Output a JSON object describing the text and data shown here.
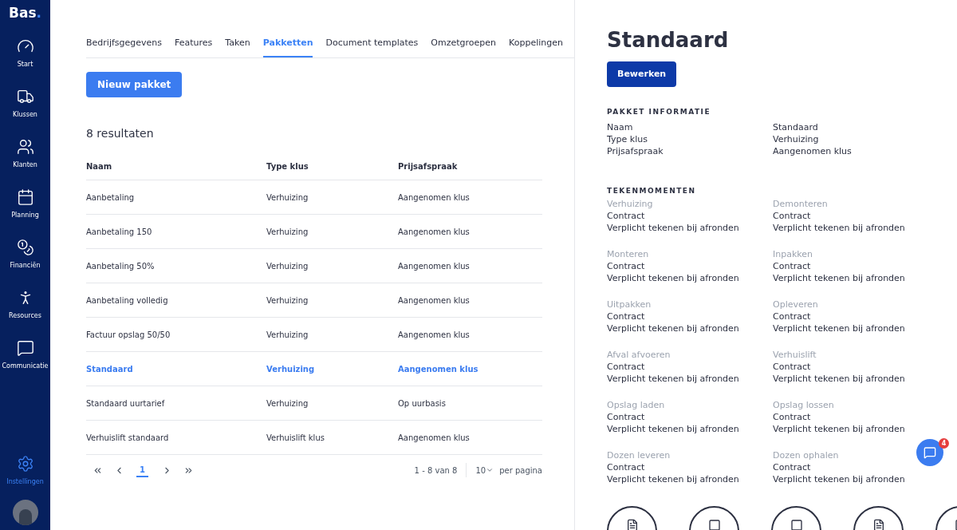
{
  "sidebar": {
    "logo": "Bas",
    "logo_dot": ".",
    "items": [
      {
        "label": "Start",
        "selected": false
      },
      {
        "label": "Klussen",
        "selected": false
      },
      {
        "label": "Klanten",
        "selected": false
      },
      {
        "label": "Planning",
        "selected": false
      },
      {
        "label": "Financiën",
        "selected": false
      },
      {
        "label": "Resources",
        "selected": false
      },
      {
        "label": "Communicatie",
        "selected": false
      }
    ],
    "bottom_item": {
      "label": "Instellingen",
      "selected": true
    }
  },
  "tabs": [
    {
      "label": "Bedrijfsgegevens",
      "selected": false
    },
    {
      "label": "Features",
      "selected": false
    },
    {
      "label": "Taken",
      "selected": false
    },
    {
      "label": "Pakketten",
      "selected": true
    },
    {
      "label": "Document templates",
      "selected": false
    },
    {
      "label": "Omzetgroepen",
      "selected": false
    },
    {
      "label": "Koppelingen",
      "selected": false
    }
  ],
  "new_button": "Nieuw pakket",
  "result_count": "8 resultaten",
  "table": {
    "columns": [
      "Naam",
      "Type klus",
      "Prijsafspraak"
    ],
    "rows": [
      {
        "cells": [
          "Aanbetaling",
          "Verhuizing",
          "Aangenomen klus"
        ],
        "selected": false
      },
      {
        "cells": [
          "Aanbetaling 150",
          "Verhuizing",
          "Aangenomen klus"
        ],
        "selected": false
      },
      {
        "cells": [
          "Aanbetaling 50%",
          "Verhuizing",
          "Aangenomen klus"
        ],
        "selected": false
      },
      {
        "cells": [
          "Aanbetaling volledig",
          "Verhuizing",
          "Aangenomen klus"
        ],
        "selected": false
      },
      {
        "cells": [
          "Factuur opslag 50/50",
          "Verhuizing",
          "Aangenomen klus"
        ],
        "selected": false
      },
      {
        "cells": [
          "Standaard",
          "Verhuizing",
          "Aangenomen klus"
        ],
        "selected": true
      },
      {
        "cells": [
          "Standaard uurtarief",
          "Verhuizing",
          "Op uurbasis"
        ],
        "selected": false
      },
      {
        "cells": [
          "Verhuislift standaard",
          "Verhuislift klus",
          "Aangenomen klus"
        ],
        "selected": false
      }
    ]
  },
  "pagination": {
    "current_page": "1",
    "range": "1 - 8 van 8",
    "page_size": "10",
    "per_page": "per pagina"
  },
  "detail": {
    "title": "Standaard",
    "edit_button": "Bewerken",
    "info_heading": "PAKKET INFORMATIE",
    "info": [
      {
        "label": "Naam",
        "value": "Standaard"
      },
      {
        "label": "Type klus",
        "value": "Verhuizing"
      },
      {
        "label": "Prijsafspraak",
        "value": "Aangenomen klus"
      }
    ],
    "moments_heading": "TEKENMOMENTEN",
    "moments": [
      {
        "name": "Verhuizing",
        "document": "Contract",
        "rule": "Verplicht tekenen bij afronden"
      },
      {
        "name": "Demonteren",
        "document": "Contract",
        "rule": "Verplicht tekenen bij afronden"
      },
      {
        "name": "Monteren",
        "document": "Contract",
        "rule": "Verplicht tekenen bij afronden"
      },
      {
        "name": "Inpakken",
        "document": "Contract",
        "rule": "Verplicht tekenen bij afronden"
      },
      {
        "name": "Uitpakken",
        "document": "Contract",
        "rule": "Verplicht tekenen bij afronden"
      },
      {
        "name": "Opleveren",
        "document": "Contract",
        "rule": "Verplicht tekenen bij afronden"
      },
      {
        "name": "Afval afvoeren",
        "document": "Contract",
        "rule": "Verplicht tekenen bij afronden"
      },
      {
        "name": "Verhuislift",
        "document": "Contract",
        "rule": "Verplicht tekenen bij afronden"
      },
      {
        "name": "Opslag laden",
        "document": "Contract",
        "rule": "Verplicht tekenen bij afronden"
      },
      {
        "name": "Opslag lossen",
        "document": "Contract",
        "rule": "Verplicht tekenen bij afronden"
      },
      {
        "name": "Dozen leveren",
        "document": "Contract",
        "rule": "Verplicht tekenen bij afronden"
      },
      {
        "name": "Dozen ophalen",
        "document": "Contract",
        "rule": "Verplicht tekenen bij afronden"
      }
    ]
  },
  "chat_badge": "4"
}
